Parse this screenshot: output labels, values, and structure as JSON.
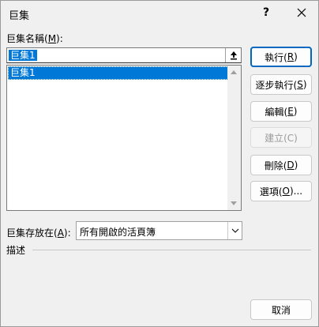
{
  "window": {
    "title": "巨集",
    "help_label": "?"
  },
  "macro_name": {
    "label": "巨集名稱(",
    "hotkey": "M",
    "label_end": "):",
    "value": "巨集1"
  },
  "macro_list": {
    "items": [
      "巨集1"
    ]
  },
  "buttons": {
    "run": {
      "label": "執行(",
      "hotkey": "R",
      "end": ")"
    },
    "step": {
      "label": "逐步執行(",
      "hotkey": "S",
      "end": ")"
    },
    "edit": {
      "label": "編輯(",
      "hotkey": "E",
      "end": ")"
    },
    "create": {
      "label": "建立(C)"
    },
    "delete": {
      "label": "刪除(",
      "hotkey": "D",
      "end": ")"
    },
    "options": {
      "label": "選項(",
      "hotkey": "O",
      "end": ")..."
    },
    "cancel": {
      "label": "取消"
    }
  },
  "macros_in": {
    "label": "巨集存放在(",
    "hotkey": "A",
    "label_end": "):",
    "value": "所有開啟的活頁簿"
  },
  "description": {
    "label": "描述"
  }
}
